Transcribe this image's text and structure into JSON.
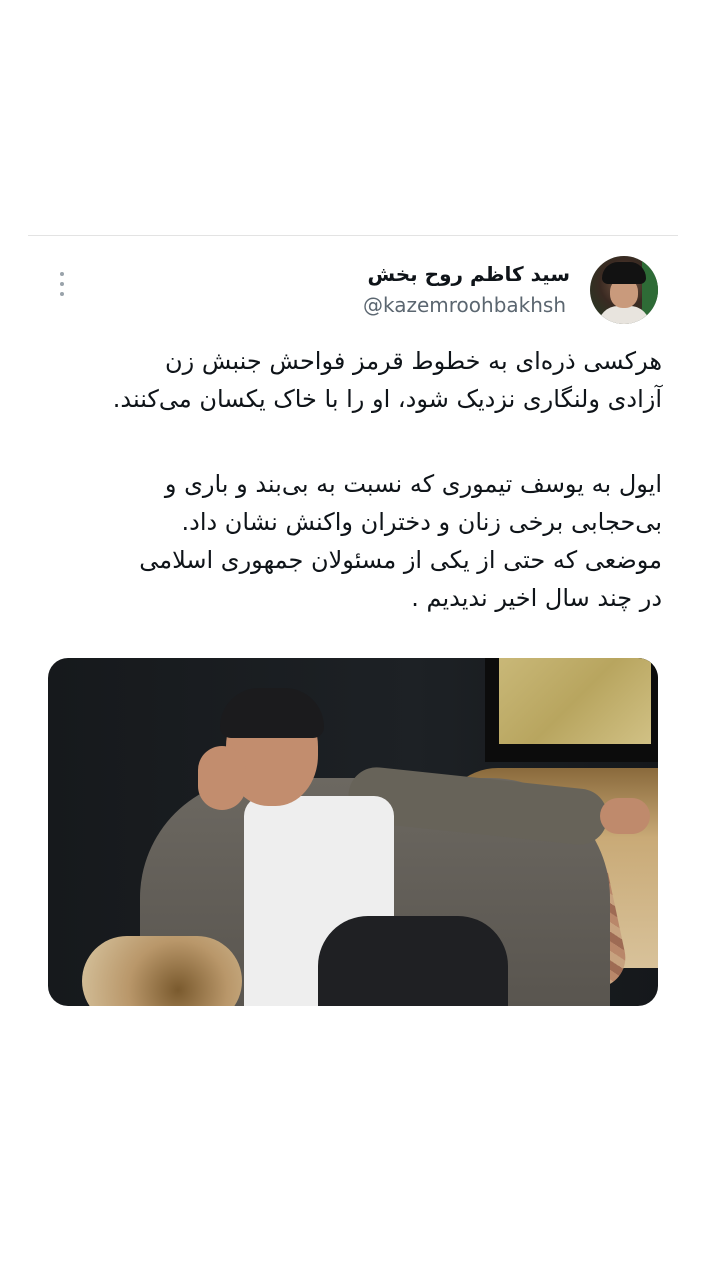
{
  "tweet": {
    "author_name": "سید کاظم روح بخش",
    "author_handle": "@kazemroohbakhsh",
    "more_icon": "more-vertical-icon",
    "paragraph1": [
      "هرکسی ذره‌ای به خطوط قرمز فواحش جنبش زن",
      "آزادی ولنگاری نزدیک شود، او را با خاک یکسان می‌کنند."
    ],
    "paragraph2": [
      "ایول به یوسف تیموری که نسبت به بی‌بند و باری و",
      "بی‌حجابی برخی زنان و دختران واکنش نشان داد.",
      "موضعی که حتی از یکی از مسئولان جمهوری اسلامی",
      "در چند سال اخیر ندیدیم ."
    ]
  }
}
